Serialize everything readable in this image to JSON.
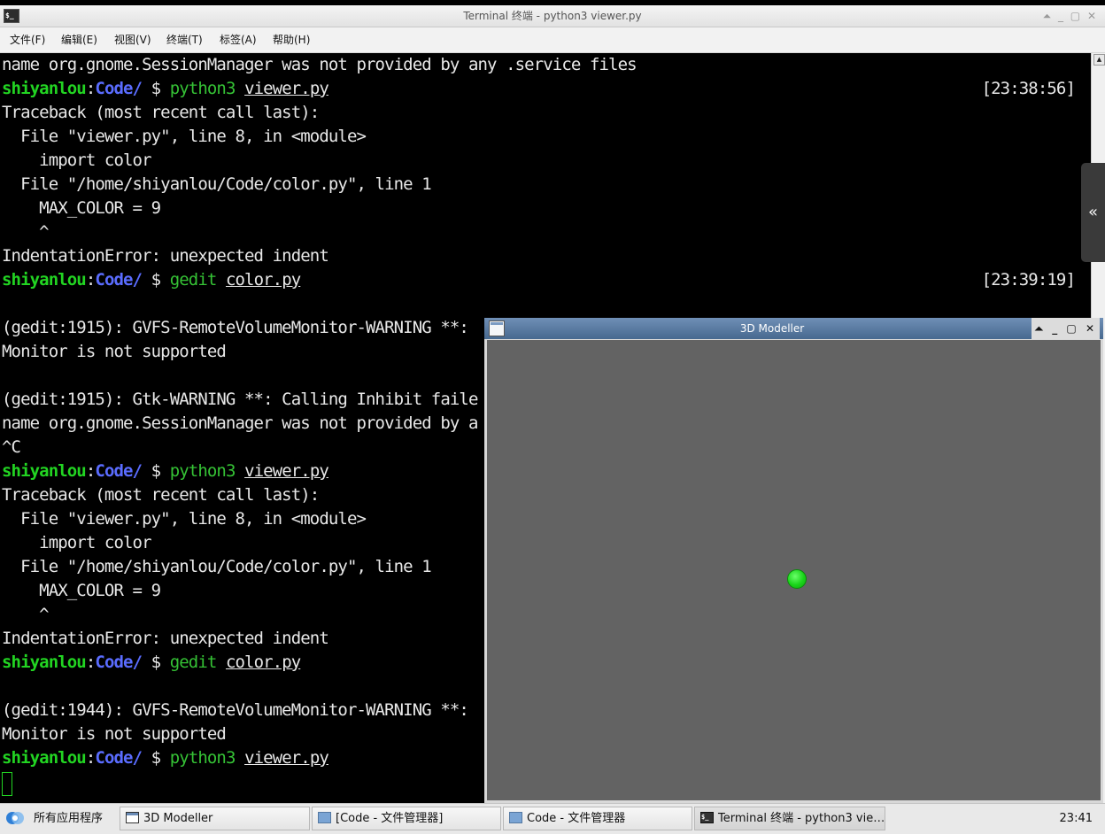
{
  "terminal_window": {
    "title": "Terminal 终端 - python3 viewer.py",
    "controls": "⏶ _ ▢ ✕",
    "menu": [
      "文件(F)",
      "编辑(E)",
      "视图(V)",
      "终端(T)",
      "标签(A)",
      "帮助(H)"
    ],
    "scroll_up_glyph": "▲",
    "side_handle_glyph": "«"
  },
  "terminal_lines": [
    {
      "text": "name org.gnome.SessionManager was not provided by any .service files"
    },
    {
      "prompt": {
        "user": "shiyanlou",
        "sep": ":",
        "path": "Code/",
        "dollar": " $ ",
        "cmd": "python3",
        "arg": "viewer.py"
      },
      "time": "[23:38:56]"
    },
    {
      "text": "Traceback (most recent call last):"
    },
    {
      "text": "  File \"viewer.py\", line 8, in <module>"
    },
    {
      "text": "    import color"
    },
    {
      "text": "  File \"/home/shiyanlou/Code/color.py\", line 1"
    },
    {
      "text": "    MAX_COLOR = 9"
    },
    {
      "text": "    ^"
    },
    {
      "text": "IndentationError: unexpected indent"
    },
    {
      "prompt": {
        "user": "shiyanlou",
        "sep": ":",
        "path": "Code/",
        "dollar": " $ ",
        "cmd": "gedit",
        "arg": "color.py"
      },
      "time": "[23:39:19]"
    },
    {
      "text": ""
    },
    {
      "text": "(gedit:1915): GVFS-RemoteVolumeMonitor-WARNING **:"
    },
    {
      "text": "Monitor is not supported"
    },
    {
      "text": ""
    },
    {
      "text": "(gedit:1915): Gtk-WARNING **: Calling Inhibit faile"
    },
    {
      "text": "name org.gnome.SessionManager was not provided by a"
    },
    {
      "text": "^C"
    },
    {
      "prompt": {
        "user": "shiyanlou",
        "sep": ":",
        "path": "Code/",
        "dollar": " $ ",
        "cmd": "python3",
        "arg": "viewer.py"
      }
    },
    {
      "text": "Traceback (most recent call last):"
    },
    {
      "text": "  File \"viewer.py\", line 8, in <module>"
    },
    {
      "text": "    import color"
    },
    {
      "text": "  File \"/home/shiyanlou/Code/color.py\", line 1"
    },
    {
      "text": "    MAX_COLOR = 9"
    },
    {
      "text": "    ^"
    },
    {
      "text": "IndentationError: unexpected indent"
    },
    {
      "prompt": {
        "user": "shiyanlou",
        "sep": ":",
        "path": "Code/",
        "dollar": " $ ",
        "cmd": "gedit",
        "arg": "color.py"
      }
    },
    {
      "text": ""
    },
    {
      "text": "(gedit:1944): GVFS-RemoteVolumeMonitor-WARNING **:"
    },
    {
      "text": "Monitor is not supported"
    },
    {
      "prompt": {
        "user": "shiyanlou",
        "sep": ":",
        "path": "Code/",
        "dollar": " $ ",
        "cmd": "python3",
        "arg": "viewer.py"
      }
    }
  ],
  "modeller_window": {
    "title": "3D Modeller",
    "controls": "⏶ _ ▢ ✕",
    "canvas_color": "#636363",
    "sphere_color": "#1fd91f"
  },
  "colors": {
    "prompt_user": "#22d422",
    "prompt_path": "#5a6cff",
    "prompt_cmd": "#35c235"
  },
  "taskbar": {
    "start_label": "所有应用程序",
    "tasks": [
      {
        "label": "3D Modeller",
        "icon": "window-icon"
      },
      {
        "label": "[Code - 文件管理器]",
        "icon": "folder-icon"
      },
      {
        "label": "Code - 文件管理器",
        "icon": "folder-icon"
      },
      {
        "label": "Terminal 终端 - python3 vie…",
        "icon": "terminal-icon"
      }
    ],
    "clock": "23:41"
  }
}
